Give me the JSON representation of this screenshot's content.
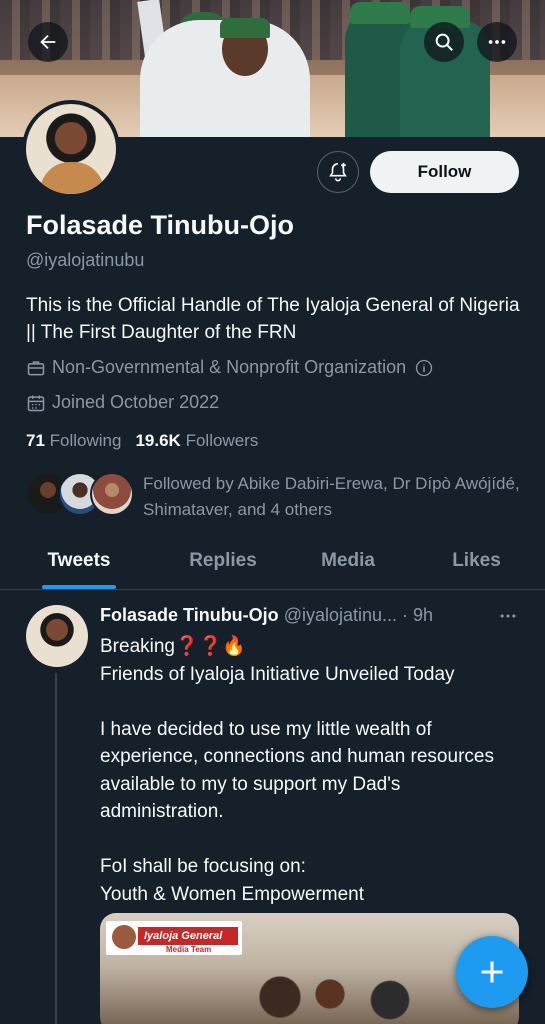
{
  "profile": {
    "name": "Folasade Tinubu-Ojo",
    "handle": "@iyalojatinubu",
    "bio": "This is the Official Handle of The Iyaloja General of Nigeria || The First Daughter of the FRN",
    "category": "Non-Governmental & Nonprofit Organization",
    "joined": "Joined October 2022",
    "following_count": "71",
    "following_label": "Following",
    "followers_count": "19.6K",
    "followers_label": "Followers",
    "followed_by": "Followed by Abike Dabiri-Erewa, Dr Dípò Awójídé, Shimataver, and 4 others"
  },
  "actions": {
    "follow_label": "Follow"
  },
  "tabs": [
    {
      "label": "Tweets",
      "active": true
    },
    {
      "label": "Replies",
      "active": false
    },
    {
      "label": "Media",
      "active": false
    },
    {
      "label": "Likes",
      "active": false
    }
  ],
  "tweet": {
    "author_name": "Folasade Tinubu-Ojo",
    "author_handle": "@iyalojatinu...",
    "time": "· 9h",
    "text": "Breaking❓❓🔥\nFriends of Iyaloja Initiative Unveiled Today\n\nI have decided to use my little wealth of experience, connections and human resources available to my to support my Dad's administration.\n\nFoI shall be focusing on:\nYouth & Women Empowerment",
    "media_tag": "Iyaloja General",
    "media_subtag": "Media Team"
  },
  "colors": {
    "background": "#15202b",
    "accent": "#1d9bf0",
    "muted": "#8b98a5"
  }
}
